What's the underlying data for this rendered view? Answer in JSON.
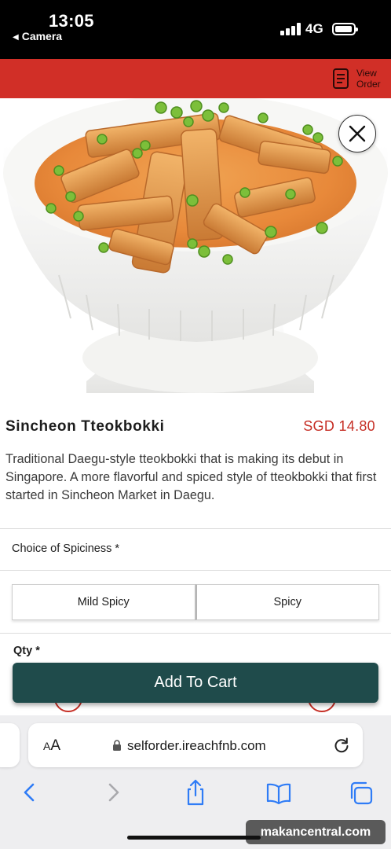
{
  "status_bar": {
    "time": "13:05",
    "back_app": "Camera",
    "network": "4G"
  },
  "header": {
    "view_order_label": "View Order",
    "bar_color": "#d12f27"
  },
  "product": {
    "name": "Sincheon Tteokbokki",
    "price": "SGD 14.80",
    "description": "Traditional Daegu-style tteokbokki that is making its debut in Singapore. A more flavorful and spiced style of tteokbokki that first started in Sincheon Market in Daegu.",
    "image_icon": "tteokbokki-bowl-photo"
  },
  "spiciness": {
    "label": "Choice of Spiciness *",
    "options": [
      "Mild Spicy",
      "Spicy"
    ]
  },
  "quantity": {
    "label": "Qty *"
  },
  "cart": {
    "button_label": "Add To Cart",
    "color": "#1f4b4b"
  },
  "browser": {
    "aa_label": "AA",
    "url": "selforder.ireachfnb.com"
  },
  "watermark": "makancentral.com",
  "colors": {
    "accent_red": "#c62f26",
    "button_teal": "#1f4b4b"
  },
  "icons": [
    "close-icon",
    "view-order-icon",
    "lock-icon",
    "reload-icon",
    "back-icon",
    "forward-icon",
    "share-icon",
    "bookmarks-icon",
    "tabs-icon"
  ]
}
